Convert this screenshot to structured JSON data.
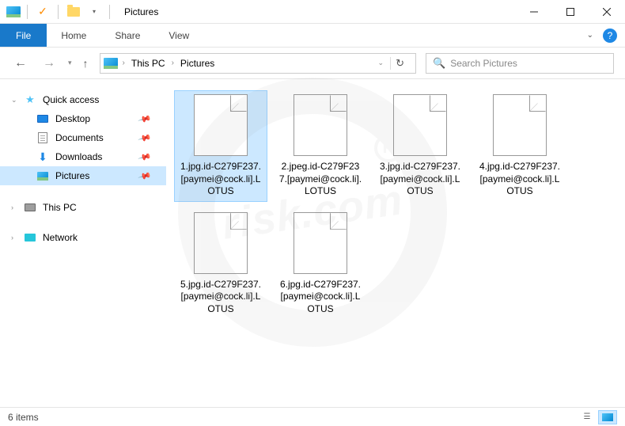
{
  "window": {
    "title": "Pictures"
  },
  "ribbon_tabs": {
    "file": "File",
    "home": "Home",
    "share": "Share",
    "view": "View"
  },
  "breadcrumb": {
    "root": "This PC",
    "current": "Pictures"
  },
  "search": {
    "placeholder": "Search Pictures"
  },
  "sidebar": {
    "quick_access": "Quick access",
    "desktop": "Desktop",
    "documents": "Documents",
    "downloads": "Downloads",
    "pictures": "Pictures",
    "this_pc": "This PC",
    "network": "Network"
  },
  "files": [
    {
      "name": "1.jpg.id-C279F237.[paymei@cock.li].LOTUS"
    },
    {
      "name": "2.jpeg.id-C279F237.[paymei@cock.li].LOTUS"
    },
    {
      "name": "3.jpg.id-C279F237.[paymei@cock.li].LOTUS"
    },
    {
      "name": "4.jpg.id-C279F237.[paymei@cock.li].LOTUS"
    },
    {
      "name": "5.jpg.id-C279F237.[paymei@cock.li].LOTUS"
    },
    {
      "name": "6.jpg.id-C279F237.[paymei@cock.li].LOTUS"
    }
  ],
  "statusbar": {
    "item_count": "6 items"
  },
  "watermark": {
    "text": "risk.com",
    "reg": "R"
  }
}
